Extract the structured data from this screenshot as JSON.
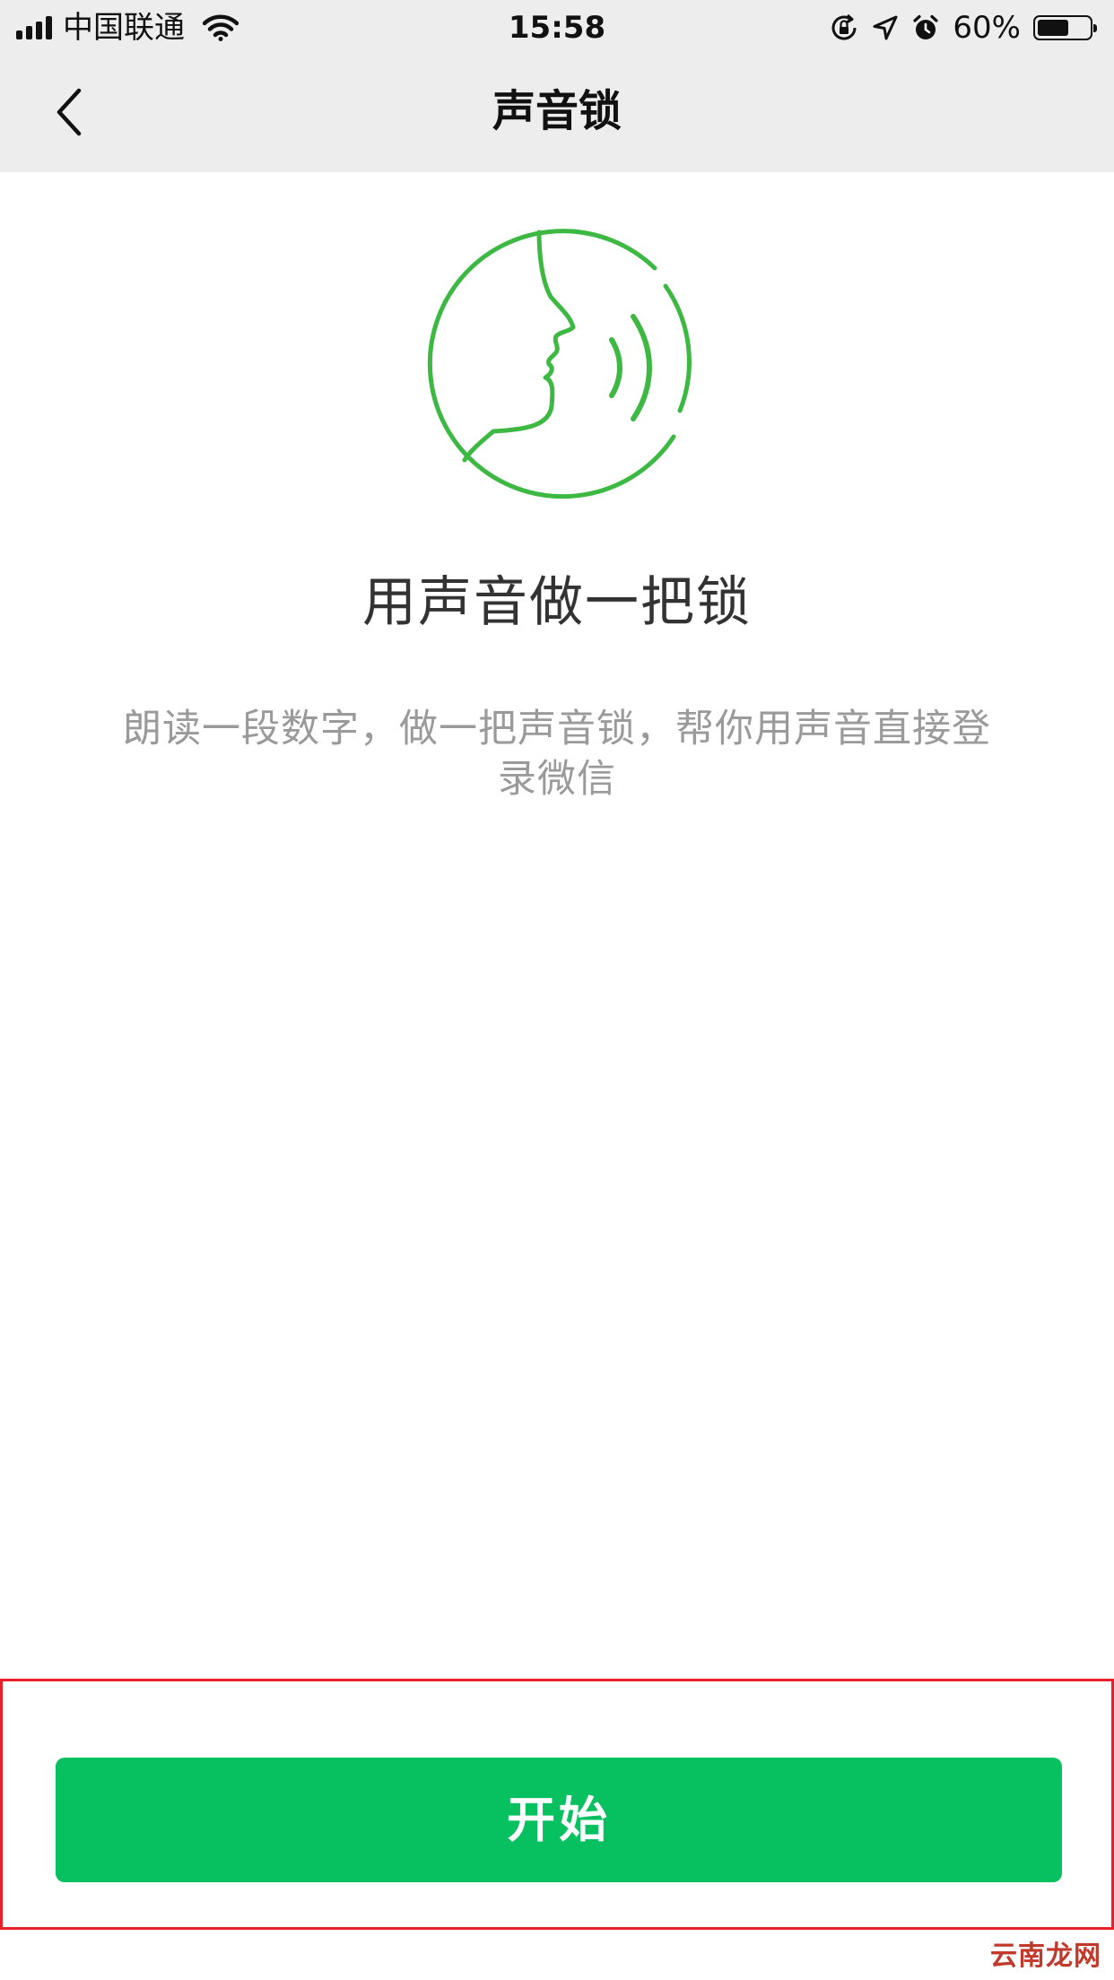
{
  "status_bar": {
    "carrier": "中国联通",
    "time": "15:58",
    "battery_percent": "60%",
    "battery_level": 0.6,
    "icons": [
      "signal-icon",
      "wifi-icon",
      "orientation-lock-icon",
      "location-arrow-icon",
      "alarm-icon",
      "battery-icon"
    ]
  },
  "nav": {
    "title": "声音锁",
    "back_icon": "chevron-left-icon"
  },
  "main": {
    "illustration_icon": "voice-face-icon",
    "headline": "用声音做一把锁",
    "description": "朗读一段数字，做一把声音锁，帮你用声音直接登录微信"
  },
  "action": {
    "start_label": "开始"
  },
  "watermark": {
    "text": "云南龙网"
  },
  "colors": {
    "accent_green": "#07c160",
    "illustration_green": "#3db843",
    "highlight_border": "#e8202a",
    "nav_background": "#ededed"
  }
}
